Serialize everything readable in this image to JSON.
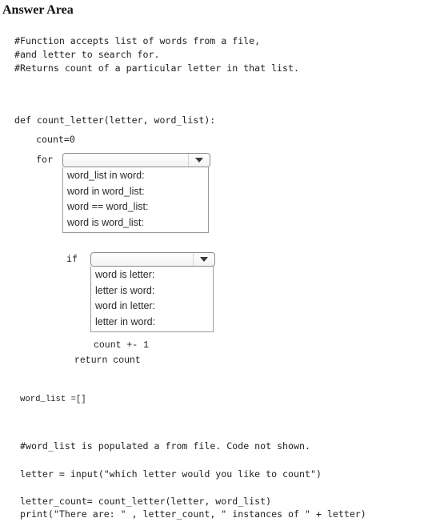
{
  "title": "Answer Area",
  "header_comments": [
    "#Function accepts list of words from a file,",
    "#and letter to search for.",
    "#Returns count of a particular letter in that list."
  ],
  "function_def": "def count_letter(letter, word_list):",
  "count_init": "count=0",
  "for_keyword": "for",
  "for_dropdown": {
    "selected": "",
    "options": [
      "word_list in word:",
      "word in word_list:",
      "word == word_list:",
      "word is word_list:"
    ]
  },
  "if_keyword": "if",
  "if_dropdown": {
    "selected": "",
    "options": [
      "word is letter:",
      "letter is word:",
      "word in letter:",
      "letter in word:"
    ]
  },
  "increment": "count +- 1",
  "return_stmt": "return count",
  "word_list_init": "word_list =[]",
  "populate_comment": "#word_list is populated a from file. Code not shown.",
  "input_line": "letter = input(\"which letter would you like to count\")",
  "call_line": "letter_count= count_letter(letter, word_list)",
  "print_line": "print(\"There are: \" , letter_count, \" instances of \" + letter)"
}
